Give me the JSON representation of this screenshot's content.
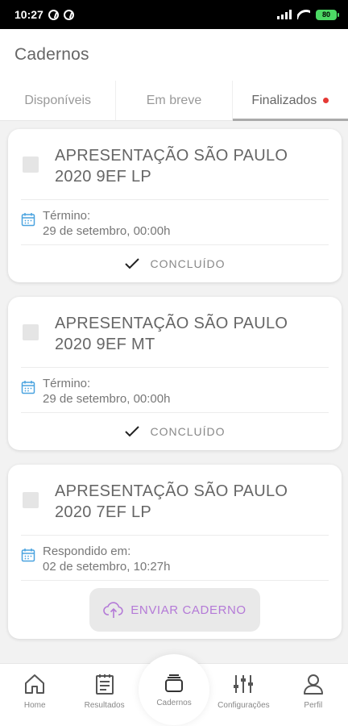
{
  "status_bar": {
    "time": "10:27",
    "battery": "80"
  },
  "header": {
    "title": "Cadernos"
  },
  "tabs": [
    {
      "label": "Disponíveis",
      "active": false
    },
    {
      "label": "Em breve",
      "active": false
    },
    {
      "label": "Finalizados",
      "active": true
    }
  ],
  "cards": [
    {
      "title": "APRESENTAÇÃO SÃO PAULO 2020 9EF LP",
      "date_label": "Término:",
      "date_value": "29 de setembro, 00:00h",
      "status": "CONCLUÍDO"
    },
    {
      "title": "APRESENTAÇÃO SÃO PAULO 2020 9EF MT",
      "date_label": "Término:",
      "date_value": "29 de setembro, 00:00h",
      "status": "CONCLUÍDO"
    },
    {
      "title": "APRESENTAÇÃO SÃO PAULO 2020 7EF LP",
      "date_label": "Respondido em:",
      "date_value": "02 de setembro, 10:27h",
      "action": "ENVIAR CADERNO"
    }
  ],
  "nav": [
    {
      "label": "Home",
      "icon": "home-icon"
    },
    {
      "label": "Resultados",
      "icon": "clipboard-icon"
    },
    {
      "label": "Cadernos",
      "icon": "notebook-icon"
    },
    {
      "label": "Configurações",
      "icon": "sliders-icon"
    },
    {
      "label": "Perfil",
      "icon": "user-icon"
    }
  ],
  "colors": {
    "accent": "#b47ad7",
    "calendar": "#4aa3df",
    "notification_dot": "#e53935",
    "battery": "#4cd964"
  }
}
